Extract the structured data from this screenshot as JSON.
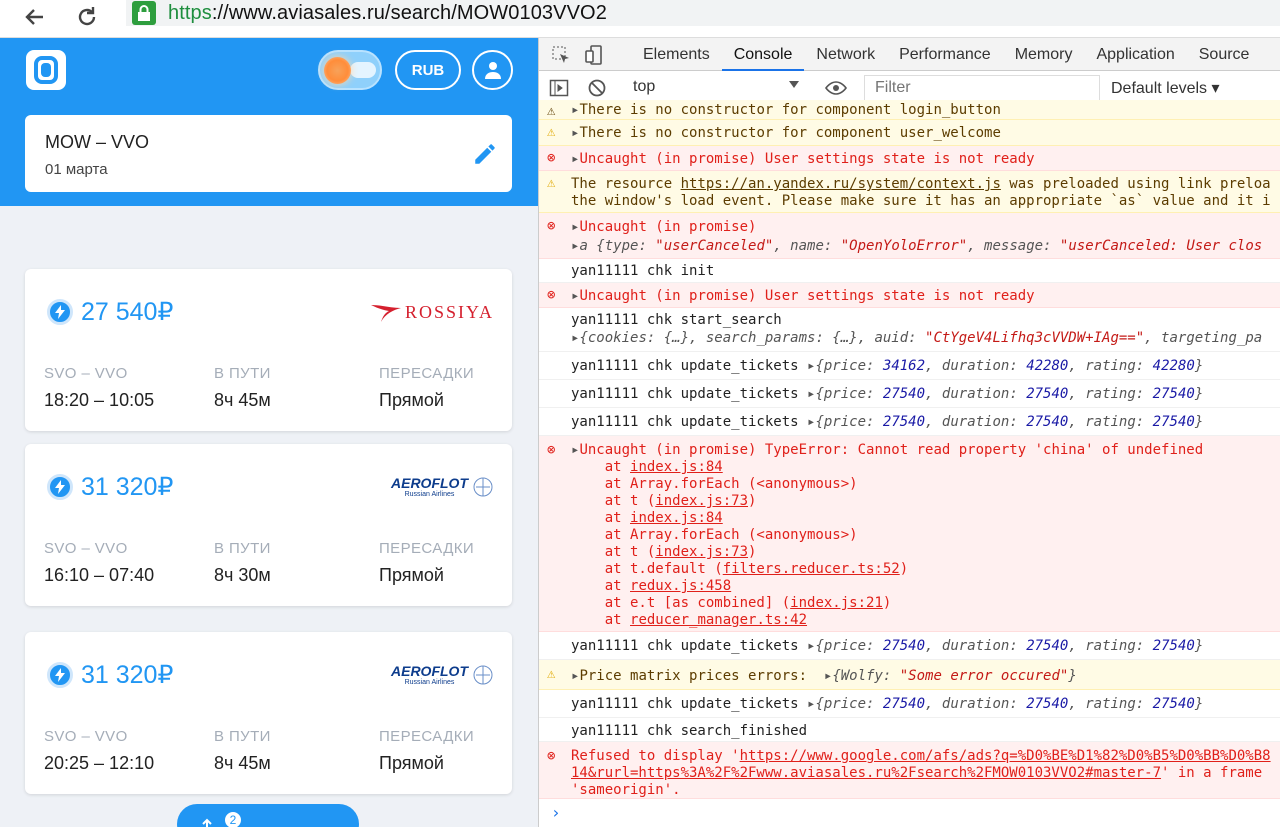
{
  "browser": {
    "url_proto": "https",
    "url_rest": "://www.aviasales.ru/search/MOW0103VVO2"
  },
  "app": {
    "currency_label": "RUB",
    "search": {
      "route": "MOW – VVO",
      "date": "01 марта"
    },
    "tickets": [
      {
        "price": "27 540₽",
        "airline": "ROSSIYA",
        "airline_sub": "",
        "route": "SVO – VVO",
        "times": "18:20 – 10:05",
        "duration": "8ч 45м",
        "stops": "Прямой"
      },
      {
        "price": "31 320₽",
        "airline": "AEROFLOT",
        "airline_sub": "Russian Airlines",
        "route": "SVO – VVO",
        "times": "16:10 – 07:40",
        "duration": "8ч 30м",
        "stops": "Прямой"
      },
      {
        "price": "31 320₽",
        "airline": "AEROFLOT",
        "airline_sub": "Russian Airlines",
        "route": "SVO – VVO",
        "times": "20:25 – 12:10",
        "duration": "8ч 45м",
        "stops": "Прямой"
      }
    ],
    "col_headers": {
      "route": "SVO – VVO",
      "duration": "В ПУТИ",
      "stops": "ПЕРЕСАДКИ"
    },
    "filter_badge": "2"
  },
  "devtools": {
    "tabs": [
      "Elements",
      "Console",
      "Network",
      "Performance",
      "Memory",
      "Application",
      "Source"
    ],
    "active_tab": "Console",
    "context": "top",
    "filter_placeholder": "Filter",
    "levels": "Default levels"
  },
  "colors": {
    "brand": "#2196f3",
    "error": "#e0201a",
    "warning_bg": "#fffbe5"
  }
}
